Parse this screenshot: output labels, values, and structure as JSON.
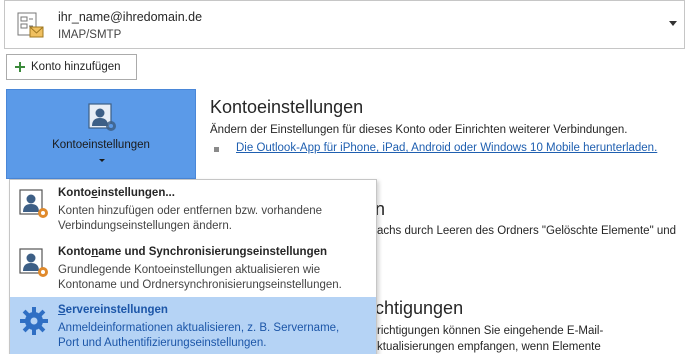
{
  "account": {
    "email": "ihr_name@ihredomain.de",
    "type": "IMAP/SMTP"
  },
  "add_account_label": "Konto hinzufügen",
  "big_button_label": "Kontoeinstellungen",
  "section1": {
    "title": "Kontoeinstellungen",
    "description": "Ändern der Einstellungen für dieses Konto oder Einrichten weiterer Verbindungen.",
    "link": "Die Outlook-App für iPhone, iPad, Android oder Windows 10 Mobile herunterladen."
  },
  "section2": {
    "title_fragment": "n",
    "text_fragment": "achs durch Leeren des Ordners \"Gelöschte Elemente\" und"
  },
  "section3": {
    "title_fragment": "chtigungen",
    "text_a": "richtigungen können Sie eingehende E-Mail-",
    "text_b": "ktualisierungen empfangen, wenn Elemente"
  },
  "menu": {
    "items": [
      {
        "title_pre": "Konto",
        "title_u": "e",
        "title_post": "instellungen...",
        "desc1": "Konten hinzufügen oder entfernen bzw. vorhandene",
        "desc2": "Verbindungseinstellungen ändern."
      },
      {
        "title_pre": "Konto",
        "title_u": "n",
        "title_post": "ame und Synchronisierungseinstellungen",
        "desc1": "Grundlegende Kontoeinstellungen aktualisieren wie",
        "desc2": "Kontoname und Ordnersynchronisierungseinstellungen."
      },
      {
        "title_pre": "",
        "title_u": "S",
        "title_post": "ervereinstellungen",
        "desc1": "Anmeldeinformationen aktualisieren, z. B. Servername,",
        "desc2": "Port und Authentifizierungseinstellungen."
      }
    ]
  },
  "colors": {
    "accent": "#5b9ae8",
    "menu_highlight": "#b5d3f5",
    "link": "#1f5fb0"
  }
}
